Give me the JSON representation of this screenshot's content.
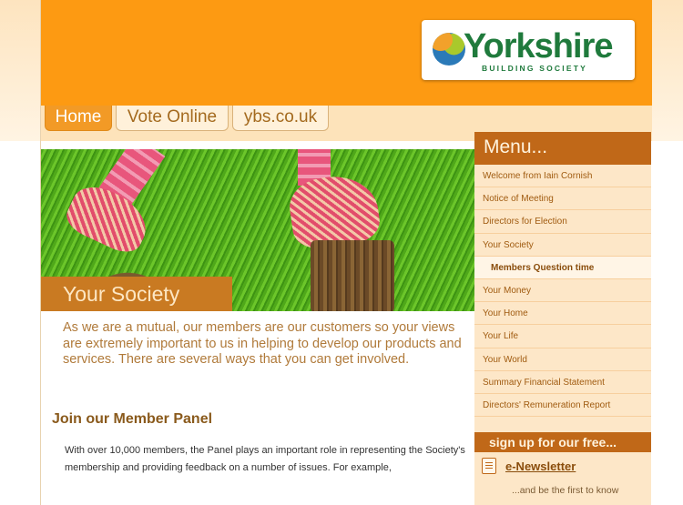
{
  "brand": {
    "name": "Yorkshire",
    "sub": "BUILDING SOCIETY"
  },
  "tabs": [
    {
      "label": "Home"
    },
    {
      "label": "Vote Online"
    },
    {
      "label": "ybs.co.uk"
    }
  ],
  "hero": {
    "caption": "Your Society"
  },
  "content": {
    "intro": "As we are a mutual, our members are our customers so your views are extremely important to us in helping to develop our products and services. There are several ways that you can get involved.",
    "panel_heading": "Join our Member Panel",
    "panel_text": "With over 10,000 members, the Panel plays an important role in representing the Society's membership and providing feedback on a number of issues. For example,"
  },
  "menu": {
    "title": "Menu...",
    "items": [
      {
        "label": "Welcome from Iain Cornish"
      },
      {
        "label": "Notice of Meeting"
      },
      {
        "label": "Directors for Election"
      },
      {
        "label": "Your Society"
      },
      {
        "label": "Members Question time"
      },
      {
        "label": "Your Money"
      },
      {
        "label": "Your Home"
      },
      {
        "label": "Your Life"
      },
      {
        "label": "Your World"
      },
      {
        "label": "Summary Financial Statement"
      },
      {
        "label": "Directors' Remuneration Report"
      }
    ]
  },
  "signup": {
    "heading": "sign up for our free...",
    "newsletter": "e-Newsletter",
    "newsletter_desc": "...and be the first to know"
  },
  "colors": {
    "header_orange": "#fd9a12",
    "menu_brown": "#c06818",
    "brand_green": "#1f7a3c"
  }
}
